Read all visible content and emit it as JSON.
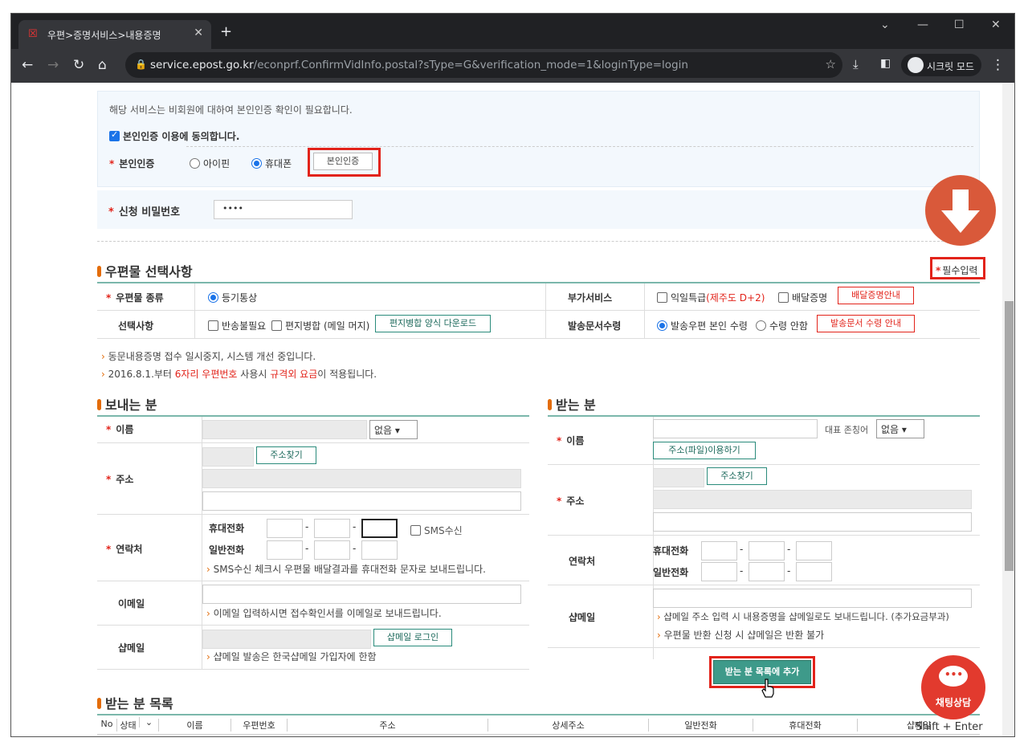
{
  "browser": {
    "tab_title": "우편>증명서비스>내용증명",
    "url_domain": "service.epost.go.kr",
    "url_path": "/econprf.ConfirmVidInfo.postal?sType=G&verification_mode=1&loginType=login",
    "incognito_label": "시크릿 모드"
  },
  "auth": {
    "notice": "해당 서비스는 비회원에 대하여 본인인증 확인이 필요합니다.",
    "agree_label": "본인인증 이용에 동의합니다.",
    "label": "본인인증",
    "opt_ipin": "아이핀",
    "opt_phone": "휴대폰",
    "button": "본인인증",
    "pw_label": "신청 비밀번호",
    "pw_value": "••••"
  },
  "mail": {
    "title": "우편물 선택사항",
    "required_note": "필수입력",
    "type_label": "우편물 종류",
    "type_value": "등기통상",
    "extra_label": "부가서비스",
    "extra_opt1": "익일특급",
    "extra_opt1_red": "(제주도 D+2)",
    "extra_opt2": "배달증명",
    "extra_btn": "배달증명안내",
    "option_label": "선택사항",
    "option1": "반송불필요",
    "option2": "편지병합 (메일 머지)",
    "option_btn": "편지병합 양식 다운로드",
    "receive_label": "발송문서수령",
    "receive_opt1": "발송우편 본인 수령",
    "receive_opt2": "수령 안함",
    "receive_btn": "발송문서 수령 안내",
    "note1": "동문내용증명 접수 일시중지, 시스템 개선 중입니다.",
    "note2_a": "2016.8.1.부터 ",
    "note2_b": "6자리 우편번호",
    "note2_c": " 사용시 ",
    "note2_d": "규격외 요금",
    "note2_e": "이 적용됩니다."
  },
  "sender": {
    "title": "보내는 분",
    "name_label": "이름",
    "honorific": "없음",
    "addr_label": "주소",
    "addr_btn": "주소찾기",
    "contact_label": "연락처",
    "mobile_label": "휴대전화",
    "phone_label": "일반전화",
    "sms_label": "SMS수신",
    "sms_note": "SMS수신 체크시 우편물 배달결과를 휴대전화 문자로 보내드립니다.",
    "email_label": "이메일",
    "email_note": "이메일 입력하시면 접수확인서를 이메일로 보내드립니다.",
    "shmail_label": "샵메일",
    "shmail_btn": "샵메일 로그인",
    "shmail_note": "샵메일 발송은 한국샵메일 가입자에 한함"
  },
  "receiver": {
    "title": "받는 분",
    "name_label": "이름",
    "rep_label": "대표 존칭어",
    "honorific": "없음",
    "file_btn": "주소(파일)이용하기",
    "addr_label": "주소",
    "addr_btn": "주소찾기",
    "contact_label": "연락처",
    "mobile_label": "휴대전화",
    "phone_label": "일반전화",
    "shmail_label": "샵메일",
    "shmail_note1": "샵메일 주소 입력 시 내용증명을 샵메일로도 보내드립니다. (추가요금부과)",
    "shmail_note2": "우편물 반환 신청 시 샵메일은 반환 불가",
    "add_btn": "받는 분 목록에 추가"
  },
  "list": {
    "title": "받는 분 목록",
    "columns": [
      "No",
      "상태",
      "",
      "이름",
      "우편번호",
      "주소",
      "상세주소",
      "일반전화",
      "휴대전화",
      "샵메일"
    ]
  },
  "chat": {
    "label": "채팅상담",
    "shortcut": "Shift + Enter"
  }
}
